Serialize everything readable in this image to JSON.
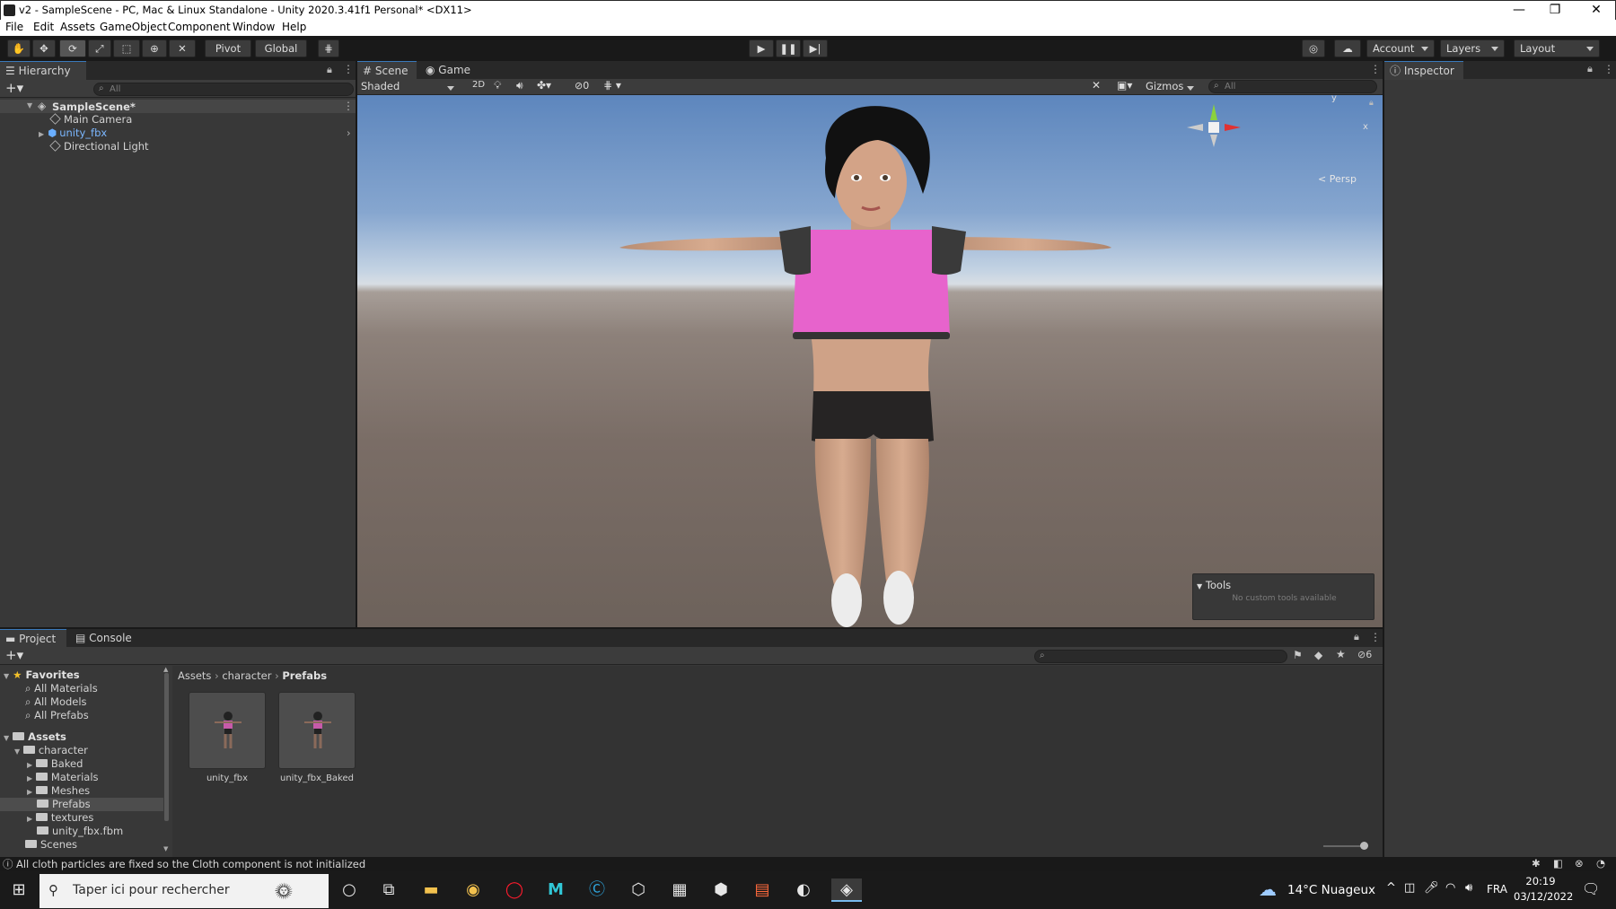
{
  "window": {
    "title": "v2 - SampleScene - PC, Mac & Linux Standalone - Unity 2020.3.41f1 Personal* <DX11>",
    "controls": [
      "—",
      "❐",
      "✕"
    ]
  },
  "menu": [
    "File",
    "Edit",
    "Assets",
    "GameObject",
    "Component",
    "Window",
    "Help"
  ],
  "toolbar": {
    "pivot": "Pivot",
    "global": "Global",
    "account": "Account",
    "layers": "Layers",
    "layout": "Layout"
  },
  "hierarchy": {
    "tab": "Hierarchy",
    "search_placeholder": "All",
    "scene": "SampleScene*",
    "items": [
      "Main Camera",
      "unity_fbx",
      "Directional Light"
    ]
  },
  "scene": {
    "tabs": [
      "Scene",
      "Game"
    ],
    "shading": "Shaded",
    "mode2d": "2D",
    "hidden_count": "0",
    "gizmos": "Gizmos",
    "search_placeholder": "All",
    "persp": "< Persp",
    "axes": {
      "y": "y",
      "x": "x"
    },
    "tools_title": "Tools",
    "tools_note": "No custom tools available"
  },
  "inspector": {
    "tab": "Inspector"
  },
  "project": {
    "tabs": [
      "Project",
      "Console"
    ],
    "badge": "6",
    "favorites_label": "Favorites",
    "favorites": [
      "All Materials",
      "All Models",
      "All Prefabs"
    ],
    "assets_label": "Assets",
    "tree": [
      "character",
      "Baked",
      "Materials",
      "Meshes",
      "Prefabs",
      "textures",
      "unity_fbx.fbm",
      "Scenes"
    ],
    "breadcrumb": [
      "Assets",
      "character",
      "Prefabs"
    ],
    "files": [
      "unity_fbx",
      "unity_fbx_Baked"
    ]
  },
  "status": "All cloth particles are fixed so the Cloth component is not initialized",
  "taskbar": {
    "search": "Taper ici pour rechercher",
    "weather": "14°C  Nuageux",
    "lang": "FRA",
    "time": "20:19",
    "date": "03/12/2022"
  },
  "colors": {
    "accent": "#3a79bb",
    "editor_bg": "#383838",
    "top_pink": "#e763cc"
  }
}
